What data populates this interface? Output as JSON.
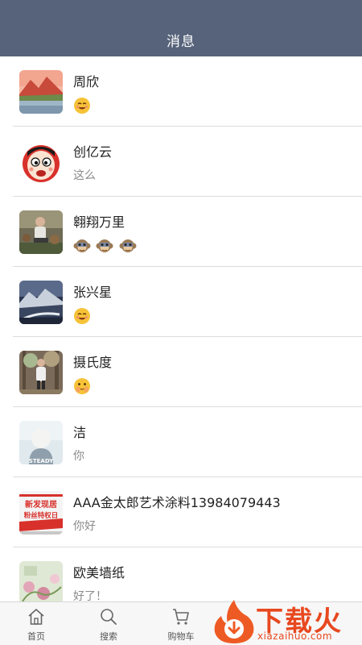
{
  "header": {
    "title": "消息"
  },
  "conversations": [
    {
      "name": "周欣",
      "preview": "",
      "emojis": [
        "grin-face"
      ],
      "avatar": "mountain-lake"
    },
    {
      "name": "创亿云",
      "preview": "这么",
      "emojis": [],
      "avatar": "cartoon-face"
    },
    {
      "name": "翱翔万里",
      "preview": "",
      "emojis": [
        "monkey-face",
        "monkey-face",
        "monkey-face"
      ],
      "avatar": "man-photo"
    },
    {
      "name": "张兴星",
      "preview": "",
      "emojis": [
        "grin-face"
      ],
      "avatar": "snow-mountain"
    },
    {
      "name": "摄氏度",
      "preview": "",
      "emojis": [
        "hush-face"
      ],
      "avatar": "person-forest"
    },
    {
      "name": "洁",
      "preview": "你",
      "emojis": [],
      "avatar": "steady-girl"
    },
    {
      "name": "AAA金太郎艺术涂料13984079443",
      "preview": "你好",
      "emojis": [],
      "avatar": "promo-poster"
    },
    {
      "name": "欧美墙纸",
      "preview": "好了！",
      "emojis": [],
      "avatar": "floral-wallpaper"
    }
  ],
  "avatar_texts": {
    "steady": "STEADY",
    "promo_line1": "新发现居",
    "promo_line2": "粉丝特权日"
  },
  "tabbar": {
    "items": [
      {
        "label": "首页",
        "icon": "home-icon"
      },
      {
        "label": "搜索",
        "icon": "search-icon"
      },
      {
        "label": "购物车",
        "icon": "cart-icon"
      }
    ]
  },
  "watermark": {
    "text": "下载火",
    "sub": "xiazaihuo.com"
  },
  "colors": {
    "header_bg": "#56637a",
    "accent": "#e8481f"
  }
}
